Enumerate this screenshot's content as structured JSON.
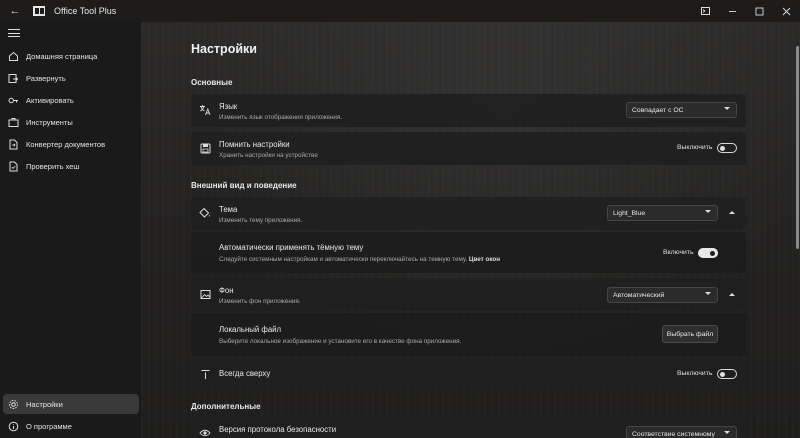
{
  "window": {
    "title": "Office Tool Plus"
  },
  "sidebar": {
    "items": [
      {
        "label": "Домашняя страница",
        "icon": "home-icon"
      },
      {
        "label": "Развернуть",
        "icon": "deploy-icon"
      },
      {
        "label": "Активировать",
        "icon": "key-icon"
      },
      {
        "label": "Инструменты",
        "icon": "toolbox-icon"
      },
      {
        "label": "Конвертер документов",
        "icon": "document-convert-icon"
      },
      {
        "label": "Проверить хеш",
        "icon": "file-check-icon"
      }
    ],
    "footer": [
      {
        "label": "Настройки",
        "icon": "gear-icon",
        "selected": true
      },
      {
        "label": "О программе",
        "icon": "info-icon"
      }
    ]
  },
  "page": {
    "title": "Настройки"
  },
  "sections": {
    "basic": "Основные",
    "appearance": "Внешний вид и поведение",
    "additional": "Дополнительные"
  },
  "settings": {
    "language": {
      "title": "Язык",
      "desc": "Изменить язык отображения приложения.",
      "value": "Совпадает с ОС"
    },
    "remember": {
      "title": "Помнить настройки",
      "desc": "Хранить настройки на устройстве",
      "toggle_label": "Выключить",
      "on": false
    },
    "theme": {
      "title": "Тема",
      "desc": "Изменить тему приложения.",
      "value": "Light_Blue"
    },
    "auto_theme": {
      "title": "Автоматически применять тёмную тему",
      "desc": "Следуйте системным настройкам и автоматически переключайтесь на темную тему.",
      "desc_bold": "Цвет окон",
      "toggle_label": "Включить",
      "on": true
    },
    "background": {
      "title": "Фон",
      "desc": "Изменить фон приложения.",
      "value": "Автоматический"
    },
    "local_file": {
      "title": "Локальный файл",
      "desc": "Выберите локальное изображение и установите его в качестве фона приложения.",
      "button": "Выбрать файл"
    },
    "always_on_top": {
      "title": "Всегда сверху",
      "toggle_label": "Выключить",
      "on": false
    },
    "security_protocol": {
      "title": "Версия протокола безопасности",
      "value": "Соответствие системному"
    }
  }
}
